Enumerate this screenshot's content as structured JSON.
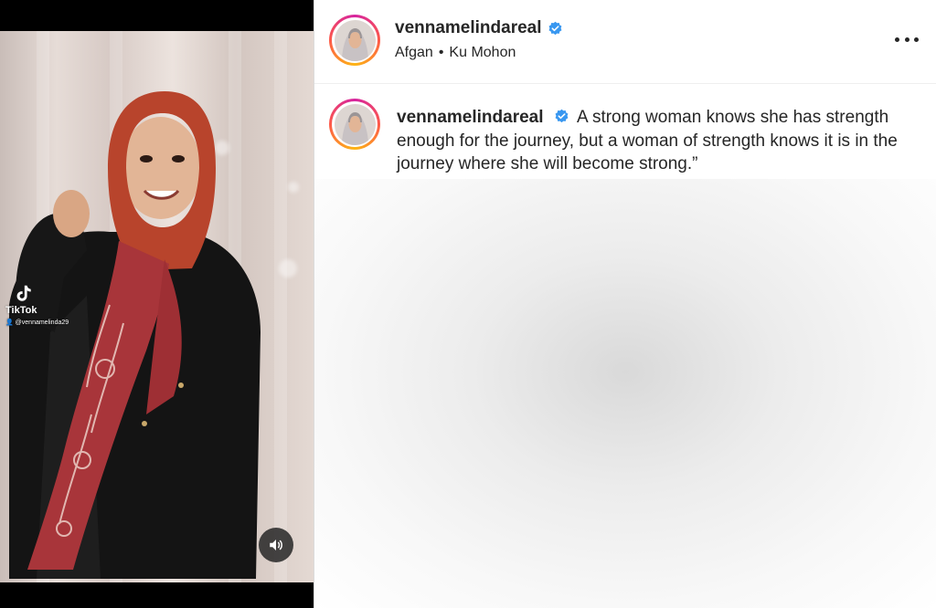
{
  "post": {
    "username": "vennamelindareal",
    "verified": true,
    "audio": {
      "artist": "Afgan",
      "separator": "•",
      "track": "Ku Mohon"
    },
    "caption": "A strong woman knows she has strength enough for the journey, but a woman of strength knows it is in the journey where she will become strong.”"
  },
  "media": {
    "watermark": {
      "brand": "TikTok",
      "handle": "@vennamelinda29"
    }
  },
  "icons": {
    "verified": "verified-badge-icon",
    "more": "more-options-icon",
    "volume": "volume-icon",
    "tiktok": "tiktok-logo-icon"
  },
  "colors": {
    "verified_blue": "#3897f0",
    "text": "#262626",
    "story_ring": "#d6249f"
  }
}
